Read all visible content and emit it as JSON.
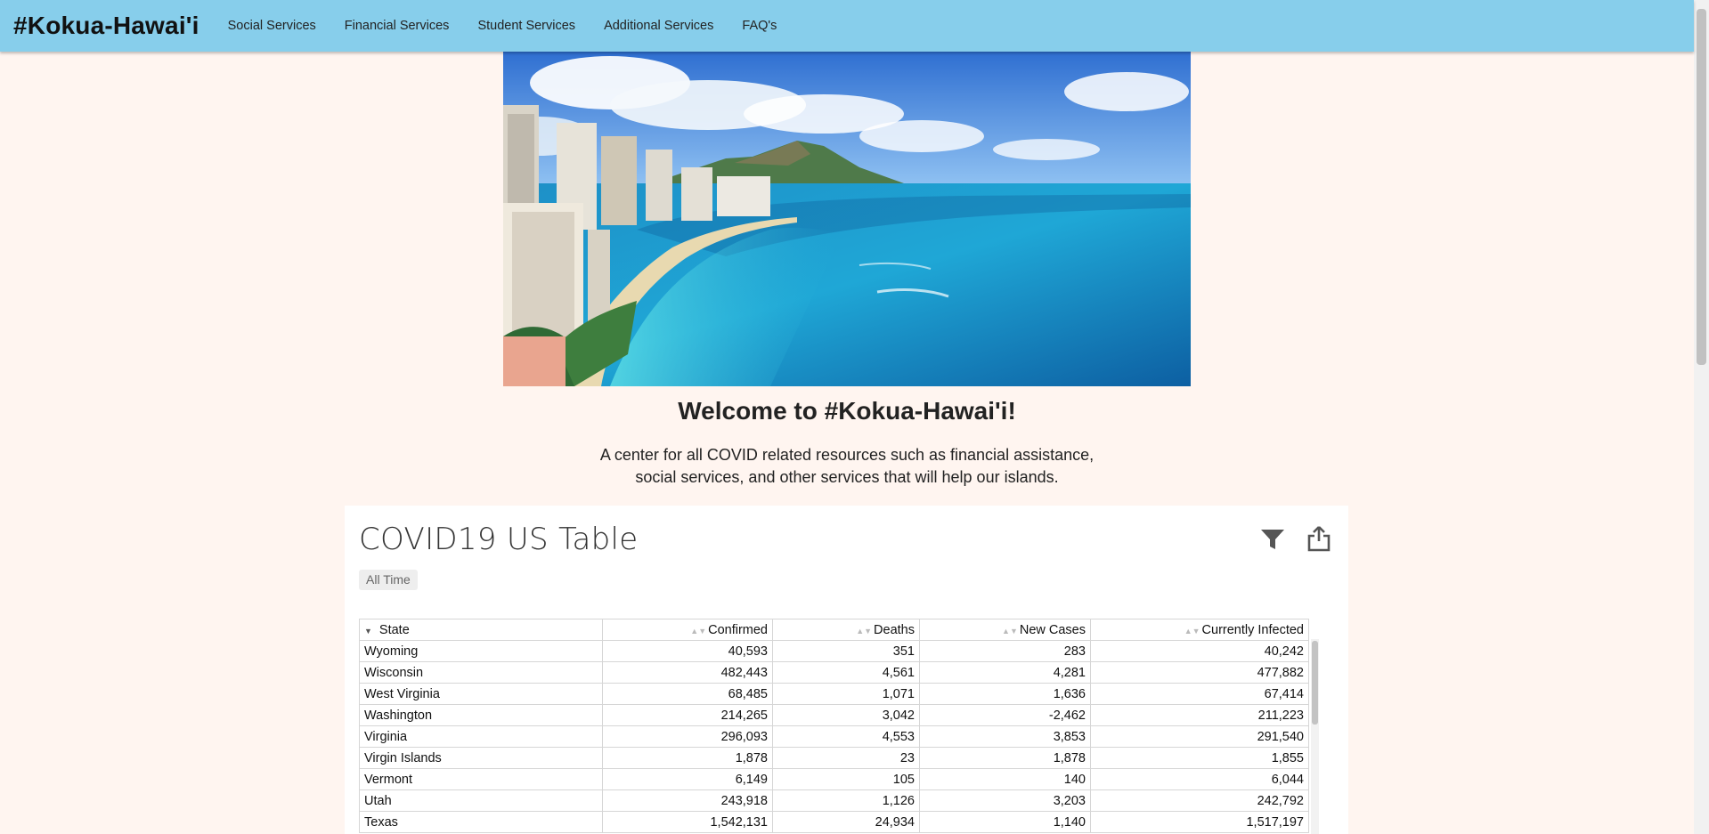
{
  "navbar": {
    "brand": "#Kokua-Hawai'i",
    "links": [
      "Social Services",
      "Financial Services",
      "Student Services",
      "Additional Services",
      "FAQ's"
    ],
    "background": "#87ceeb"
  },
  "hero": {
    "description": "Waikiki Beach and Diamond Head"
  },
  "welcome": {
    "title": "Welcome to #Kokua-Hawai'i!",
    "subtitle_line1": "A center for all COVID related resources such as financial assistance,",
    "subtitle_line2": "social services, and other services that will help our islands."
  },
  "covid_table": {
    "title": "COVID19 US Table",
    "time_filter": "All Time",
    "icons": [
      "filter-icon",
      "share-icon"
    ],
    "columns": [
      "State",
      "Confirmed",
      "Deaths",
      "New Cases",
      "Currently Infected"
    ],
    "sorted_column": "State",
    "sort_direction": "descending",
    "rows": [
      [
        "Wyoming",
        "40,593",
        "351",
        "283",
        "40,242"
      ],
      [
        "Wisconsin",
        "482,443",
        "4,561",
        "4,281",
        "477,882"
      ],
      [
        "West Virginia",
        "68,485",
        "1,071",
        "1,636",
        "67,414"
      ],
      [
        "Washington",
        "214,265",
        "3,042",
        "-2,462",
        "211,223"
      ],
      [
        "Virginia",
        "296,093",
        "4,553",
        "3,853",
        "291,540"
      ],
      [
        "Virgin Islands",
        "1,878",
        "23",
        "1,878",
        "1,855"
      ],
      [
        "Vermont",
        "6,149",
        "105",
        "140",
        "6,044"
      ],
      [
        "Utah",
        "243,918",
        "1,126",
        "3,203",
        "242,792"
      ],
      [
        "Texas",
        "1,542,131",
        "24,934",
        "1,140",
        "1,517,197"
      ]
    ]
  },
  "colors": {
    "page_background": "#fff5f0",
    "card_background": "#ffffff",
    "icon_color": "#555555"
  }
}
